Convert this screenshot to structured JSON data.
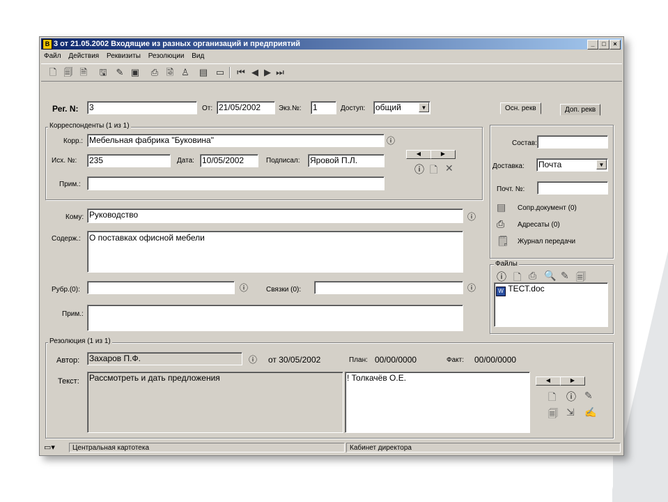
{
  "window": {
    "title": "3 от 21.05.2002 Входящие из разных организаций и предприятий",
    "icon_label": "В"
  },
  "menu": [
    "Файл",
    "Действия",
    "Реквизиты",
    "Резолюции",
    "Вид"
  ],
  "header": {
    "reg_label": "Рег. N:",
    "reg_value": "3",
    "from_label": "От:",
    "from_value": "21/05/2002",
    "copy_label": "Экз.№:",
    "copy_value": "1",
    "access_label": "Доступ:",
    "access_value": "общий"
  },
  "tabs": [
    "Осн. рекв",
    "Доп. рекв"
  ],
  "correspondents": {
    "title": "Корреспонденты (1 из 1)",
    "corr_label": "Корр.:",
    "corr_value": "Мебельная фабрика \"Буковина\"",
    "out_label": "Исх. №:",
    "out_value": "235",
    "date_label": "Дата:",
    "date_value": "10/05/2002",
    "signed_label": "Подписал:",
    "signed_value": "Яровой П.Л.",
    "note_label": "Прим.:",
    "note_value": ""
  },
  "main": {
    "to_label": "Кому:",
    "to_value": "Руководство",
    "content_label": "Содерж.:",
    "content_value": "О поставках офисной мебели",
    "rubric_label": "Рубр.(0):",
    "rubric_value": "",
    "links_label": "Связки (0):",
    "links_value": "",
    "note_label": "Прим.:",
    "note_value": ""
  },
  "right_panel": {
    "composition_label": "Состав:",
    "composition_value": "",
    "delivery_label": "Доставка:",
    "delivery_value": "Почта",
    "postal_label": "Почт. №:",
    "postal_value": "",
    "accomp_doc": "Сопр.документ (0)",
    "addressees": "Адресаты (0)",
    "transfer_log": "Журнал передачи",
    "files_title": "Файлы",
    "files": [
      "ТЕСТ.doc"
    ]
  },
  "resolution": {
    "title": "Резолюция (1 из 1)",
    "author_label": "Автор:",
    "author_value": "Захаров П.Ф.",
    "date_text": "от 30/05/2002",
    "plan_label": "План:",
    "plan_value": "00/00/0000",
    "fact_label": "Факт:",
    "fact_value": "00/00/0000",
    "text_label": "Текст:",
    "text_value": "Рассмотреть и дать предложения",
    "executor": "! Толкачёв О.Е."
  },
  "status": {
    "pane1": "Центральная картотека",
    "pane2": "Кабинет директора"
  }
}
